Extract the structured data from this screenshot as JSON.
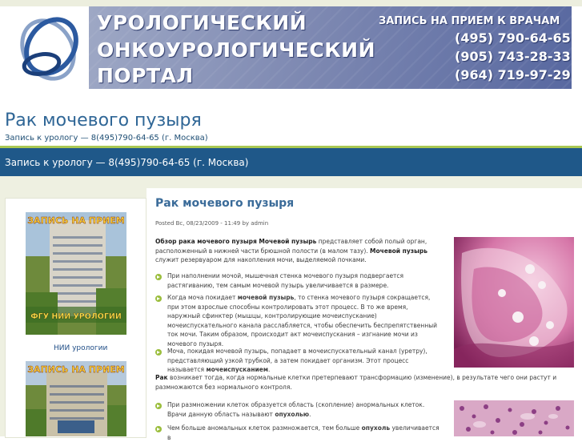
{
  "banner": {
    "line1": "УРОЛОГИЧЕСКИЙ",
    "line2": "ОНКОУРОЛОГИЧЕСКИЙ",
    "line3": "ПОРТАЛ",
    "booking": "ЗАПИСЬ НА ПРИЕМ К ВРАЧАМ",
    "phones": [
      "(495) 790-64-65",
      "(905) 743-28-33",
      "(964) 719-97-29"
    ]
  },
  "site": {
    "title": "Рак мочевого пузыря",
    "subtitle": "Запись к урологу — 8(495)790-64-65 (г. Москва)"
  },
  "nav": {
    "link": "Запись к урологу — 8(495)790-64-65 (г. Москва)"
  },
  "sidebar": {
    "ad1_heading": "ЗАПИСЬ НА ПРИЕМ",
    "ad1_footer": "ФГУ НИИ УРОЛОГИИ",
    "ad1_caption": "НИИ урологии",
    "ad2_heading": "ЗАПИСЬ НА ПРИЕМ"
  },
  "post": {
    "title": "Рак мочевого пузыря",
    "meta": "Posted Вс, 08/23/2009 - 11:49 by admin",
    "intro_bold": "Обзор рака мочевого пузыря Мочевой пузырь",
    "intro_rest": " представляет собой полый орган, расположенный в нижней части брюшной полости (в малом тазу). ",
    "intro_bold2": "Мочевой пузырь",
    "intro_rest2": " служит резервуаром для накопления мочи, выделяемой почками.",
    "bullet1": "При наполнении мочой, мышечная стенка мочевого пузыря подвергается растягиванию, тем самым мочевой пузырь увеличивается в размере.",
    "bullet2_a": "Когда моча покидает ",
    "bullet2_b": "мочевой пузырь",
    "bullet2_c": ", то стенка мочевого пузыря сокращается, при этом взрослые способны контролировать этот процесс. В то же время, наружный сфинктер (мышцы, контролирующие мочеиспускание) мочеиспускательного канала расслабляется, чтобы обеспечить беспрепятственный ток мочи. Таким образом, происходит акт мочеиспускания – изгнание мочи из мочевого пузыря.",
    "bullet3_a": "Моча, покидая мочевой пузырь, попадает в мочеиспускательный канал (уретру), представляющий узкой трубкой, а затем покидает организм. Этот процесс называется ",
    "bullet3_b": "мочеиспусканием",
    "bullet3_c": ".",
    "rak_bold": "Рак",
    "rak_rest": " возникает тогда, когда нормальные клетки претерпевают трансформацию (изменение), в результате чего они растут и размножаются без нормального контроля.",
    "bullet4_a": "При размножении клеток образуется область (скопление) анормальных клеток. Врачи данную область называют ",
    "bullet4_b": "опухолью",
    "bullet4_c": ".",
    "bullet5_a": "Чем больше аномальных клеток размножается, тем больше ",
    "bullet5_b": "опухоль",
    "bullet5_c": " увеличивается в"
  }
}
